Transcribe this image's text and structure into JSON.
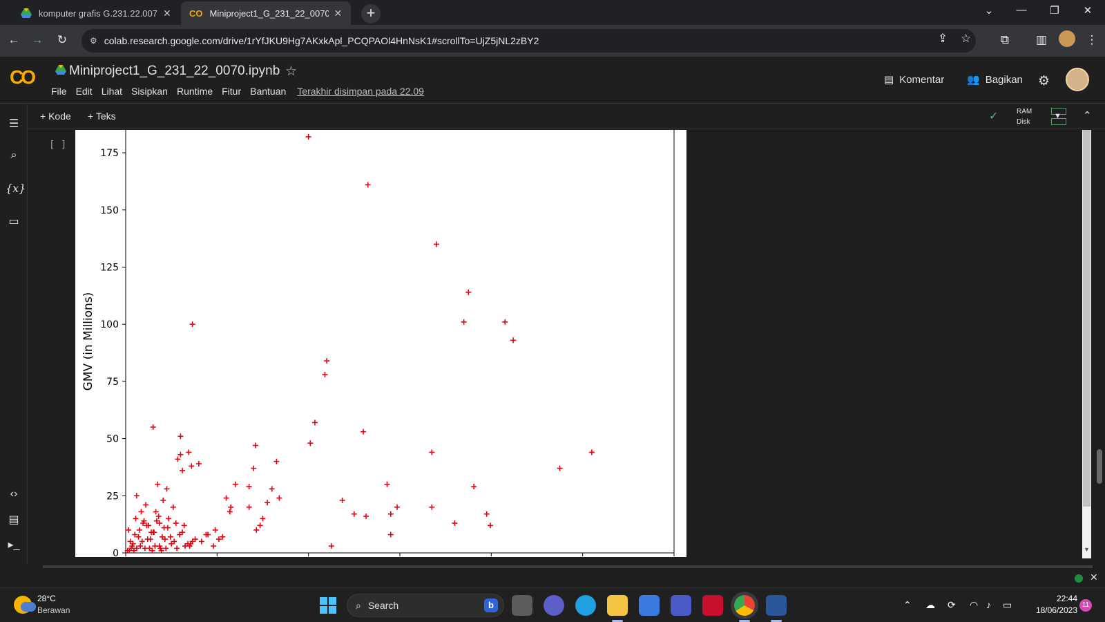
{
  "browser": {
    "tabs": [
      {
        "title": "komputer grafis G.231.22.0070",
        "active": false
      },
      {
        "title": "Miniproject1_G_231_22_0070.ipynb",
        "active": true
      }
    ],
    "url": "colab.research.google.com/drive/1rYfJKU9Hg7AKxkApl_PCQPAOl4HnNsK1#scrollTo=UjZ5jNL2zBY2"
  },
  "colab": {
    "logo": "CO",
    "notebook_title": "Miniproject1_G_231_22_0070.ipynb",
    "menu": [
      "File",
      "Edit",
      "Lihat",
      "Sisipkan",
      "Runtime",
      "Fitur",
      "Bantuan"
    ],
    "last_saved": "Terakhir disimpan pada 22.09",
    "comment_label": "Komentar",
    "share_label": "Bagikan",
    "toolbar": {
      "add_code": "+ Kode",
      "add_text": "+ Teks",
      "ram": "RAM",
      "disk": "Disk"
    },
    "cell_bracket": "[ ]"
  },
  "chart_data": {
    "type": "scatter",
    "title": "",
    "xlabel": "",
    "ylabel": "GMV (in Millions)",
    "yticks": [
      0,
      25,
      50,
      75,
      100,
      125,
      150,
      175
    ],
    "ylim": [
      0,
      185
    ],
    "xlim": [
      0,
      600
    ],
    "x_tick_labels_visible": false,
    "marker": "+",
    "color": "#e8000b",
    "series": [
      {
        "x": [
          73,
          30,
          57,
          35,
          37,
          60,
          69,
          60,
          200,
          265,
          340,
          375,
          415,
          370,
          424,
          220,
          218,
          207,
          202,
          142,
          140,
          135,
          135,
          115,
          110,
          150,
          147,
          143,
          155,
          160,
          165,
          168,
          260,
          335,
          475,
          510,
          286,
          297,
          335,
          399,
          290,
          360,
          381,
          395,
          237,
          250,
          263,
          225,
          290,
          120,
          72,
          45,
          41,
          62,
          80,
          12,
          22,
          33,
          47,
          52,
          64,
          88,
          98,
          106,
          73,
          114,
          70,
          25,
          5,
          10,
          15,
          20,
          27,
          30,
          36,
          42,
          49,
          55,
          62,
          68,
          76,
          83,
          90,
          96,
          102,
          6,
          11,
          17,
          23,
          28,
          34,
          40,
          46,
          53,
          59,
          65,
          71,
          3,
          8,
          14,
          19,
          24,
          31,
          37,
          43,
          50,
          56,
          2,
          7,
          12,
          18,
          26,
          32,
          39,
          44,
          4,
          9,
          16,
          21,
          29,
          38
        ],
        "y": [
          100,
          55,
          41,
          30,
          13,
          43,
          44,
          51,
          182,
          161,
          135,
          114,
          101,
          101,
          93,
          84,
          78,
          57,
          48,
          47,
          37,
          29,
          20,
          20,
          24,
          15,
          12,
          10,
          22,
          28,
          40,
          24,
          53,
          44,
          37,
          44,
          30,
          20,
          20,
          12,
          17,
          13,
          29,
          17,
          23,
          17,
          16,
          3,
          8,
          30,
          38,
          28,
          23,
          36,
          39,
          25,
          21,
          18,
          15,
          20,
          12,
          8,
          10,
          7,
          5,
          18,
          3,
          12,
          5,
          8,
          10,
          14,
          6,
          9,
          16,
          11,
          7,
          13,
          9,
          4,
          6,
          5,
          8,
          3,
          6,
          2,
          15,
          18,
          12,
          9,
          14,
          7,
          11,
          5,
          8,
          3,
          4,
          10,
          4,
          7,
          13,
          6,
          9,
          3,
          6,
          4,
          2,
          1,
          3,
          2,
          5,
          2,
          3,
          1,
          2,
          1,
          1,
          3,
          2,
          1,
          2
        ]
      }
    ]
  },
  "taskbar": {
    "weather_temp": "28°C",
    "weather_desc": "Berawan",
    "search_placeholder": "Search",
    "time": "22:44",
    "date": "18/06/2023",
    "notification_count": "11"
  }
}
